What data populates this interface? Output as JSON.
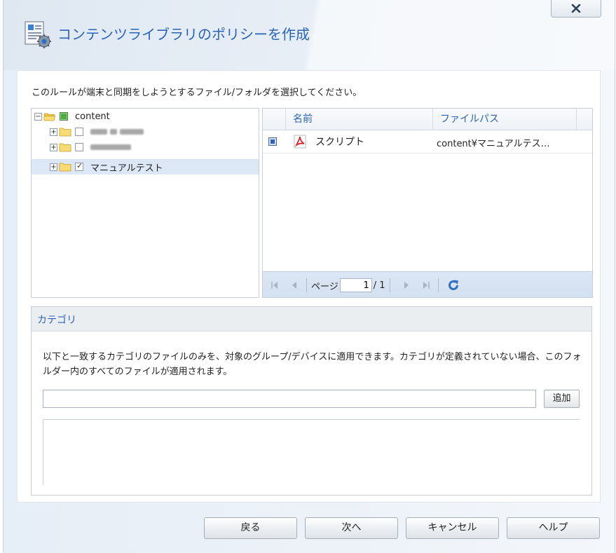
{
  "window": {
    "title": "コンテンツライブラリのポリシーを作成",
    "close_label": "x"
  },
  "instruction": "このルールが端末と同期をしようとするファイル/フォルダを選択してください。",
  "tree": {
    "root": {
      "label": "content",
      "expanded": true,
      "checked": "partial"
    },
    "children": [
      {
        "label": "",
        "redacted": true,
        "checked": false
      },
      {
        "label": "",
        "redacted": true,
        "checked": false
      },
      {
        "label": "マニュアルテスト",
        "redacted": false,
        "checked": true,
        "selected": true
      }
    ]
  },
  "grid": {
    "columns": [
      "名前",
      "ファイルパス"
    ],
    "rows": [
      {
        "checked": true,
        "icon": "pdf-icon",
        "name": "スクリプト",
        "path": "content¥マニュアルテス…"
      }
    ],
    "pager": {
      "page_label": "ページ",
      "current_page": "1",
      "total": "/ 1"
    }
  },
  "category": {
    "title": "カテゴリ",
    "description": "以下と一致するカテゴリのファイルのみを、対象のグループ/デバイスに適用できます。カテゴリが定義されていない場合、このフォルダー内のすべてのファイルが適用されます。",
    "input_value": "",
    "add_label": "追加"
  },
  "footer": {
    "back_label": "戻る",
    "next_label": "次へ",
    "cancel_label": "キャンセル",
    "help_label": "ヘルプ"
  },
  "colors": {
    "title": "#2a64b8",
    "accent": "#2f63b8",
    "selection": "#dde8f6",
    "pdf": "#d8262b"
  }
}
